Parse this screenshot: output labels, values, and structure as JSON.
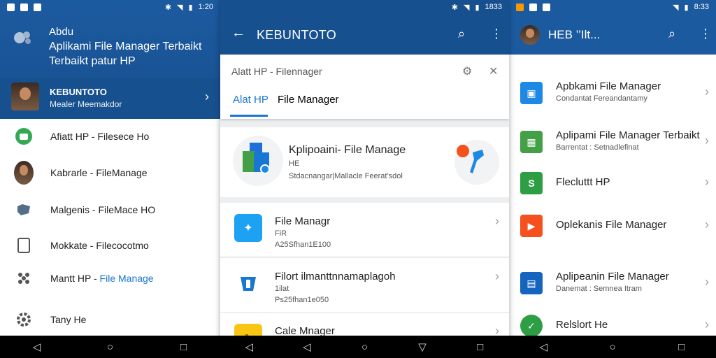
{
  "screens": {
    "drawer": {
      "status": {
        "time": "1:20"
      },
      "header": {
        "app_title": "Abdu",
        "subtitle_line1": "Aplikami File Manager Terbaikt",
        "subtitle_line2": "Terbaikt patur HP",
        "account_name": "KEBUNTOTO",
        "account_email": "Mealer Meemakdor"
      },
      "items": [
        {
          "label": "Afiatt HP - Filesece Ho",
          "icon": "green-app-icon"
        },
        {
          "label": "Kabrarle - FileManage",
          "icon": "person-avatar-icon"
        },
        {
          "label": "Malgenis - FileMace HO",
          "icon": "bubble-icon"
        },
        {
          "label": "Mokkate - Filecocotmo",
          "icon": "tablet-icon"
        },
        {
          "label_plain": "Mantt HP - ",
          "label_highlight": "File Manage",
          "icon": "dots-icon"
        },
        {
          "label": "Tany He",
          "icon": "gear-icon"
        }
      ]
    },
    "search": {
      "status": {
        "time": "1833"
      },
      "appbar_title": "KEBUNTOTO",
      "search_value": "Alatt HP - Filennager",
      "tabs": [
        {
          "label": "Alat HP",
          "active": true
        },
        {
          "label": "File Manager",
          "active": false
        }
      ],
      "featured": {
        "title": "Kplipoaini- File Manage",
        "line2": "HE",
        "line3": "Stdacnangar|Mallacle Feerat’sdol"
      },
      "rows": [
        {
          "title": "File Managr",
          "line2": "FiR",
          "line3": "A25Sfhan1E100",
          "icon": "blue-bird-icon"
        },
        {
          "title": "Filort ilmanttnnamaplagoh",
          "line2": "1ilat",
          "line3": "Ps25fhan1e050",
          "icon": "shield-icon"
        },
        {
          "title": "Cale Mnager",
          "icon": "yellow-app-icon"
        }
      ]
    },
    "list": {
      "status": {
        "time": "8:33"
      },
      "appbar_title": "HEB ’’Ilt...",
      "rows": [
        {
          "title": "Apbkami File Manager",
          "subtitle": "Condantat Fereandantamy",
          "icon": "blue-square-icon",
          "color": "#1e88e5"
        },
        {
          "title": "Aplipami File Manager Terbaikt",
          "subtitle": "Barrentat : Setnadlefinat",
          "icon": "green-chart-icon",
          "color": "#43a047"
        },
        {
          "title": "Flecluttt HP",
          "subtitle": "",
          "icon": "green-s-icon",
          "color": "#2e9e44"
        },
        {
          "title": "Oplekanis File Manager",
          "subtitle": "",
          "icon": "orange-play-icon",
          "color": "#f4511e"
        },
        {
          "title": "Aplipeanin File Manager",
          "subtitle": "Danemat : Semnea Itram",
          "icon": "blue-grid-icon",
          "color": "#1565c0"
        },
        {
          "title": "Relslort He",
          "subtitle": "",
          "icon": "green-round-icon",
          "color": "#2e9e44"
        }
      ]
    }
  }
}
